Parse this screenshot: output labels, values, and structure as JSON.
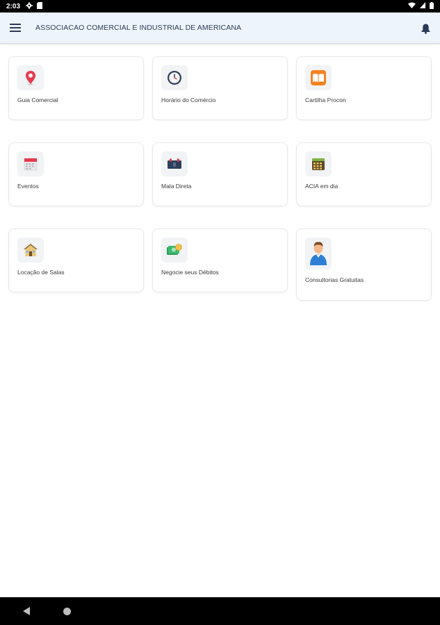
{
  "status_bar": {
    "time": "2:03"
  },
  "app_bar": {
    "title": "ASSOCIACAO COMERCIAL E INDUSTRIAL DE AMERICANA"
  },
  "tiles": [
    {
      "label": "Guia Comercial",
      "icon": "map-pin-icon"
    },
    {
      "label": "Horário do Comércio",
      "icon": "clock-icon"
    },
    {
      "label": "Cartilha Procon",
      "icon": "book-icon"
    },
    {
      "label": "Eventos",
      "icon": "calendar-icon"
    },
    {
      "label": "Mala Direta",
      "icon": "mail-bag-icon"
    },
    {
      "label": "ACIA em dia",
      "icon": "calendar-grid-icon"
    },
    {
      "label": "Locação de Salas",
      "icon": "house-icon"
    },
    {
      "label": "Negocie seus Débitos",
      "icon": "money-icon"
    },
    {
      "label": "Consultorias Gratuitas",
      "icon": "person-icon"
    }
  ]
}
